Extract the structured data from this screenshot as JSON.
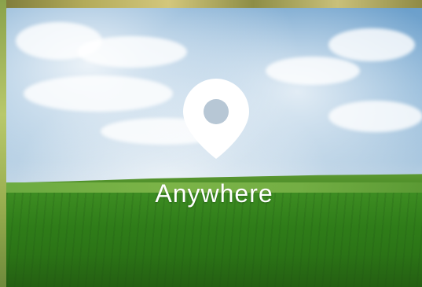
{
  "tile": {
    "label": "Anywhere",
    "icon": "map-pin-icon",
    "background": "landscape-field-under-cloudy-sky"
  },
  "colors": {
    "sky_top": "#6b9fcb",
    "field_green": "#2f7d19",
    "pin_white": "#ffffff"
  }
}
